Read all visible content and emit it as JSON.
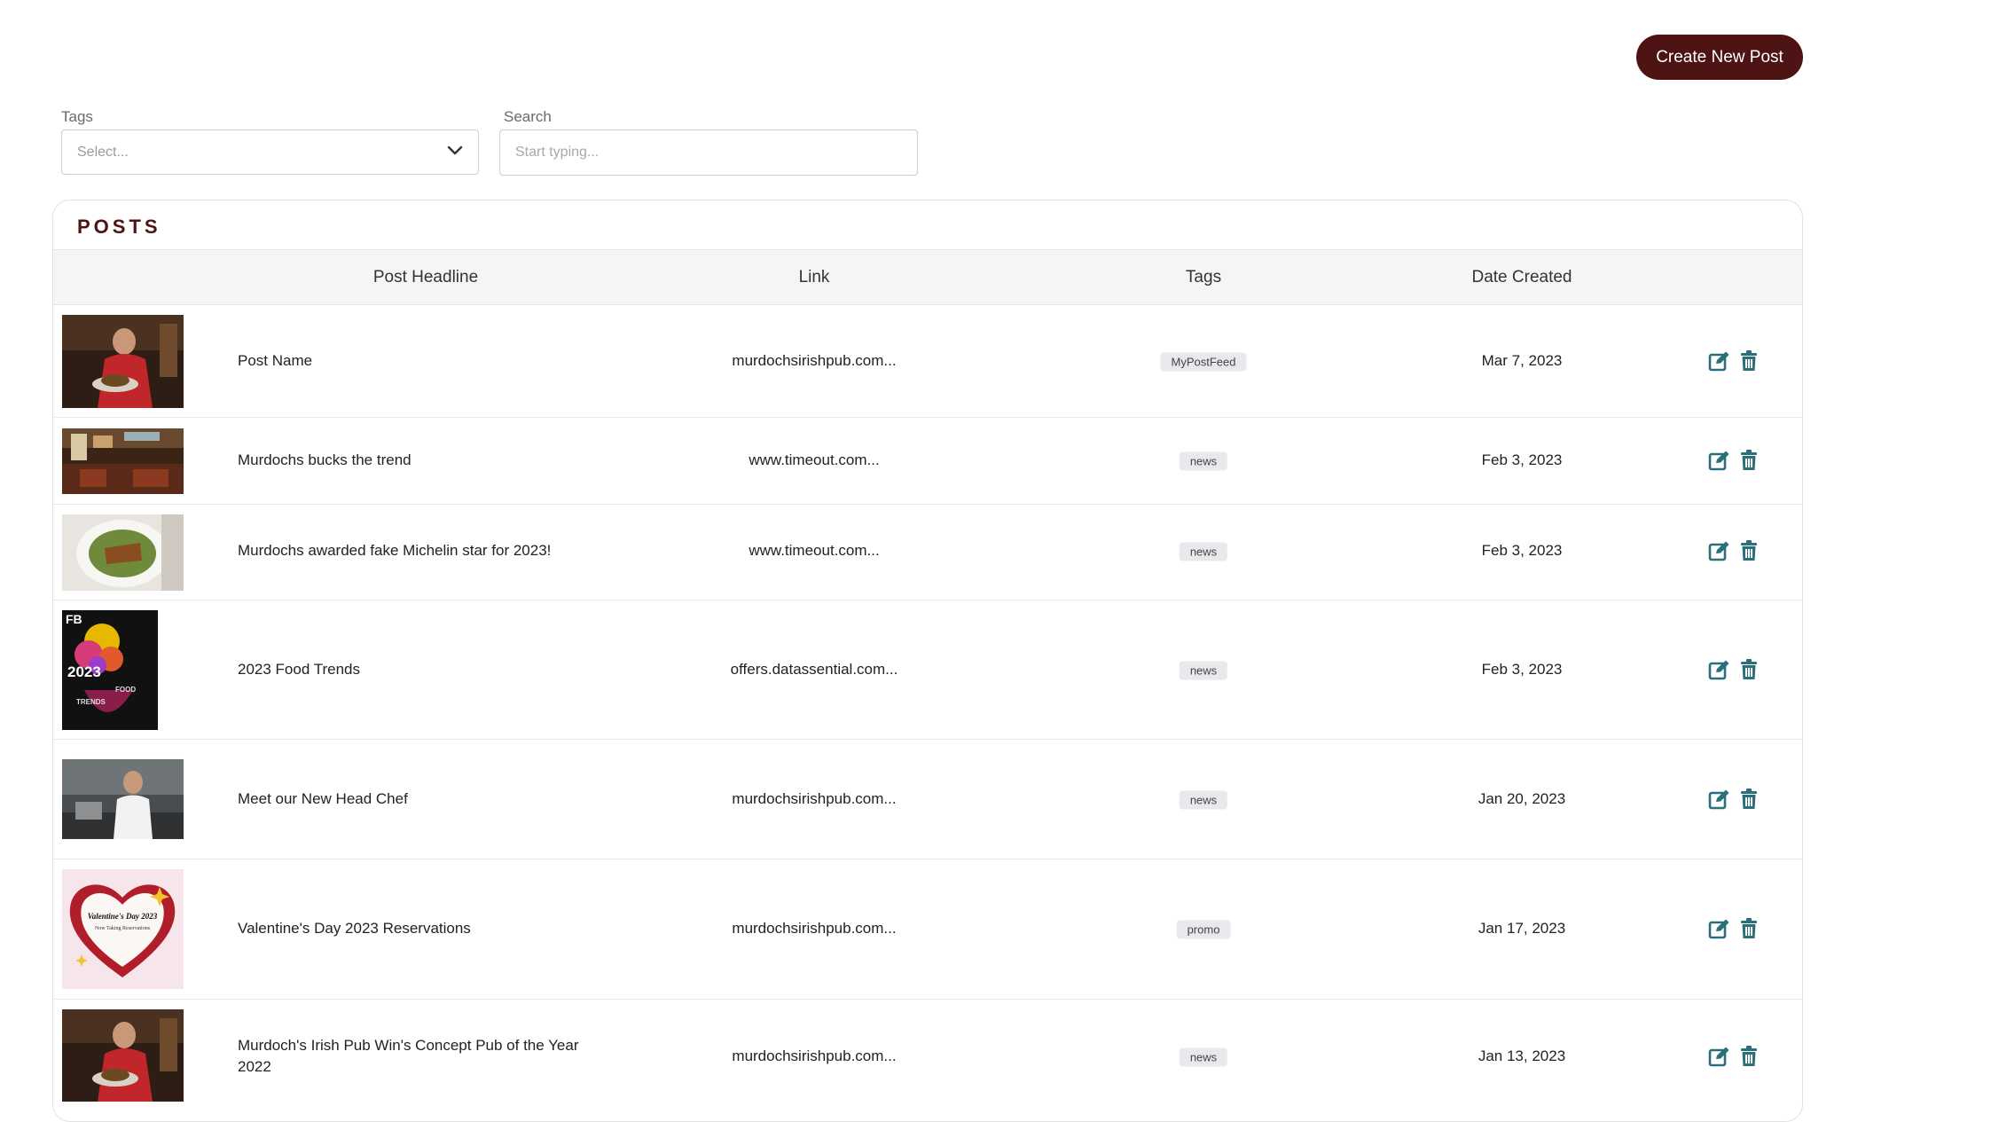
{
  "toolbar": {
    "create_label": "Create New Post"
  },
  "filters": {
    "tags_label": "Tags",
    "tags_placeholder": "Select...",
    "search_label": "Search",
    "search_placeholder": "Start typing..."
  },
  "posts": {
    "title": "POSTS",
    "columns": [
      "Post Headline",
      "Link",
      "Tags",
      "Date Created"
    ],
    "rows": [
      {
        "headline": "Post Name",
        "link": "murdochsirishpub.com...",
        "tag": "MyPostFeed",
        "date": "Mar 7, 2023"
      },
      {
        "headline": "Murdochs bucks the trend",
        "link": "www.timeout.com...",
        "tag": "news",
        "date": "Feb 3, 2023"
      },
      {
        "headline": "Murdochs awarded fake Michelin star for 2023!",
        "link": "www.timeout.com...",
        "tag": "news",
        "date": "Feb 3, 2023"
      },
      {
        "headline": "2023 Food Trends",
        "link": "offers.datassential.com...",
        "tag": "news",
        "date": "Feb 3, 2023"
      },
      {
        "headline": "Meet our New Head Chef",
        "link": "murdochsirishpub.com...",
        "tag": "news",
        "date": "Jan 20, 2023"
      },
      {
        "headline": "Valentine's Day 2023 Reservations",
        "link": "murdochsirishpub.com...",
        "tag": "promo",
        "date": "Jan 17, 2023"
      },
      {
        "headline": "Murdoch's Irish Pub Win's Concept Pub of the Year 2022",
        "link": "murdochsirishpub.com...",
        "tag": "news",
        "date": "Jan 13, 2023"
      }
    ],
    "thumb_texts": {
      "food_trends": [
        "FB",
        "2023",
        "FOOD",
        "TRENDS"
      ],
      "valentine": [
        "Valentine's Day 2023",
        "Now Taking Reservations"
      ]
    }
  },
  "colors": {
    "brand": "#4e1313",
    "icon": "#2a6f7a",
    "tag_bg": "#e7e9ec"
  },
  "icons": {
    "edit": "edit-icon",
    "delete": "trash-icon",
    "dropdown": "chevron-down-icon"
  }
}
